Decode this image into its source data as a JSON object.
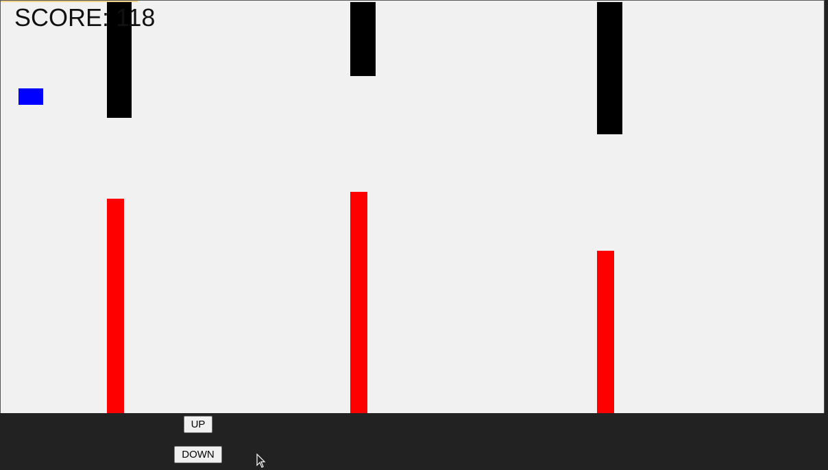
{
  "game": {
    "score_text": "SCORE: 118",
    "colors": {
      "background": "#f1f1f1",
      "panel": "#222222",
      "player": "#0000ff",
      "top_obstacle": "#000000",
      "bottom_obstacle": "#ff0000"
    }
  },
  "controls": {
    "up_label": "UP",
    "down_label": "DOWN"
  }
}
